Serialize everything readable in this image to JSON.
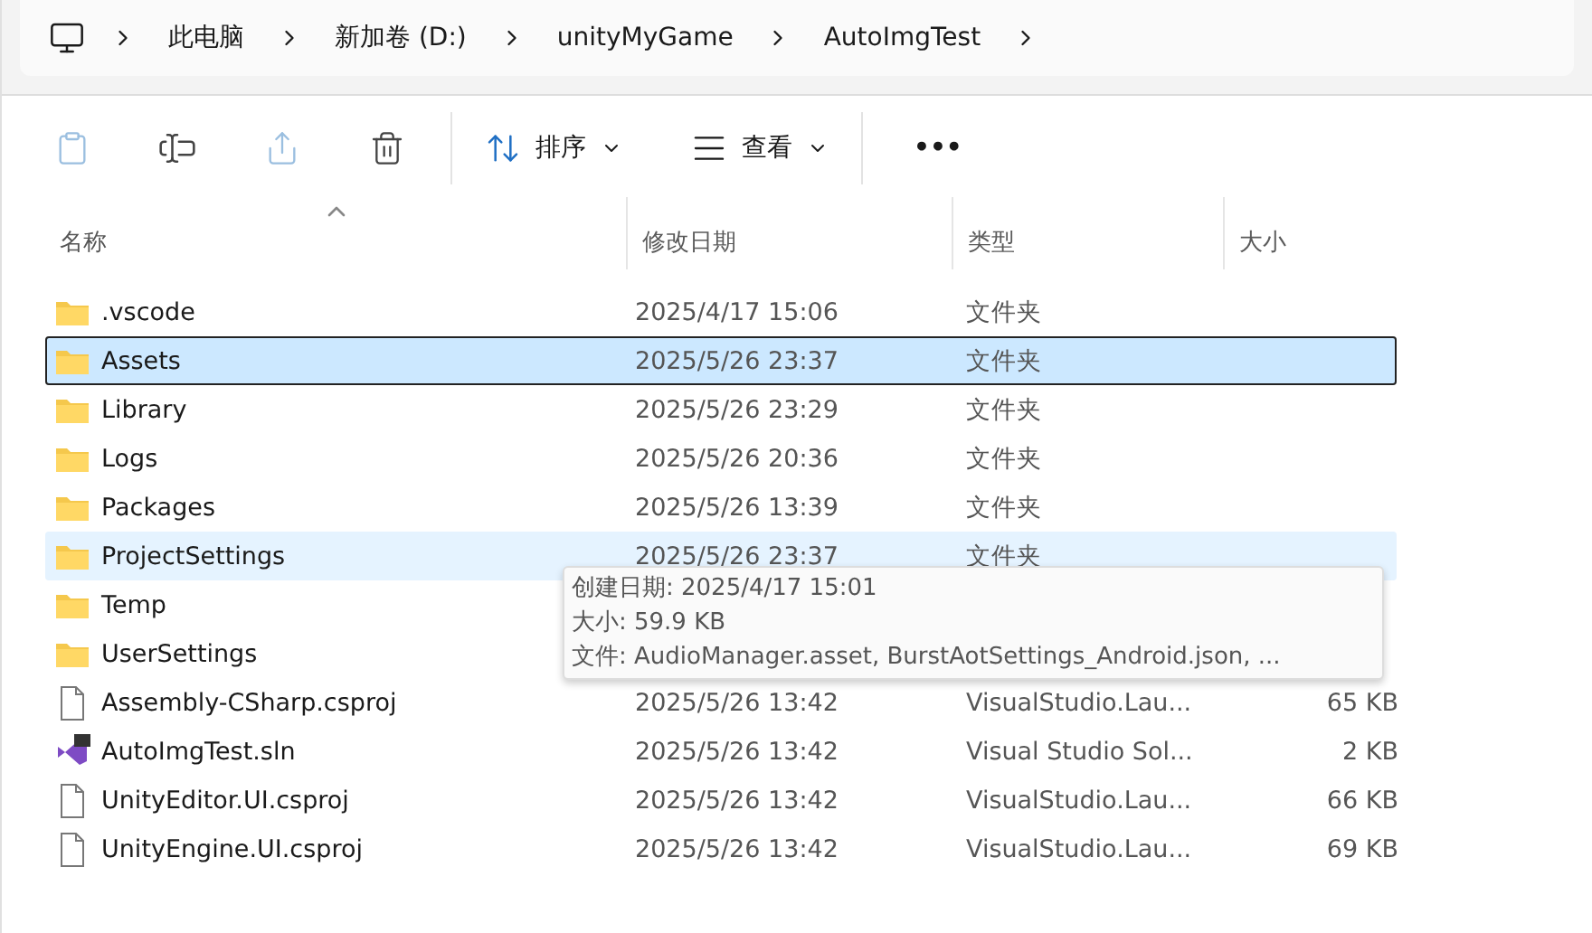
{
  "breadcrumb": [
    "此电脑",
    "新加卷 (D:)",
    "unityMyGame",
    "AutoImgTest"
  ],
  "toolbar": {
    "sort": "排序",
    "view": "查看",
    "more": "•••"
  },
  "columns": [
    {
      "label": "名称",
      "sorted": true
    },
    {
      "label": "修改日期",
      "sorted": false
    },
    {
      "label": "类型",
      "sorted": false
    },
    {
      "label": "大小",
      "sorted": false
    }
  ],
  "rows": [
    {
      "kind": "folder",
      "name": ".vscode",
      "date": "2025/4/17 15:06",
      "type": "文件夹",
      "selected": false,
      "hovered": false
    },
    {
      "kind": "folder",
      "name": "Assets",
      "date": "2025/5/26 23:37",
      "type": "文件夹",
      "selected": true,
      "hovered": false
    },
    {
      "kind": "folder",
      "name": "Library",
      "date": "2025/5/26 23:29",
      "type": "文件夹",
      "selected": false,
      "hovered": false
    },
    {
      "kind": "folder",
      "name": "Logs",
      "date": "2025/5/26 20:36",
      "type": "文件夹",
      "selected": false,
      "hovered": false
    },
    {
      "kind": "folder",
      "name": "Packages",
      "date": "2025/5/26 13:39",
      "type": "文件夹",
      "selected": false,
      "hovered": false
    },
    {
      "kind": "folder",
      "name": "ProjectSettings",
      "date": "2025/5/26 23:37",
      "type": "文件夹",
      "selected": false,
      "hovered": true
    },
    {
      "kind": "folder",
      "name": "Temp",
      "selected": false,
      "hovered": false
    },
    {
      "kind": "folder",
      "name": "UserSettings",
      "selected": false,
      "hovered": false
    },
    {
      "kind": "file",
      "name": "Assembly-CSharp.csproj",
      "date": "2025/5/26 13:42",
      "type": "VisualStudio.Lau...",
      "size": "65 KB",
      "selected": false,
      "hovered": false
    },
    {
      "kind": "solution",
      "name": "AutoImgTest.sln",
      "date": "2025/5/26 13:42",
      "type": "Visual Studio Sol...",
      "size": "2 KB",
      "selected": false,
      "hovered": false
    },
    {
      "kind": "file",
      "name": "UnityEditor.UI.csproj",
      "date": "2025/5/26 13:42",
      "type": "VisualStudio.Lau...",
      "size": "66 KB",
      "selected": false,
      "hovered": false
    },
    {
      "kind": "file",
      "name": "UnityEngine.UI.csproj",
      "date": "2025/5/26 13:42",
      "type": "VisualStudio.Lau...",
      "size": "69 KB",
      "selected": false,
      "hovered": false
    }
  ],
  "tooltip": [
    "创建日期: 2025/4/17 15:01",
    "大小: 59.9 KB",
    "文件: AudioManager.asset, BurstAotSettings_Android.json, ..."
  ]
}
